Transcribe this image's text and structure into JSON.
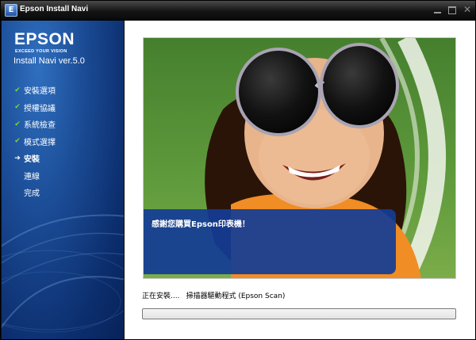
{
  "window": {
    "title": "Epson Install Navi",
    "app_icon_letter": "E",
    "controls": [
      "minimize",
      "maximize",
      "close"
    ]
  },
  "sidebar": {
    "brand": "EPSON",
    "tagline": "EXCEED YOUR VISION",
    "product": "Install Navi ver.5.0",
    "steps": [
      {
        "label": "安裝選項",
        "state": "done"
      },
      {
        "label": "授權協議",
        "state": "done"
      },
      {
        "label": "系統檢查",
        "state": "done"
      },
      {
        "label": "模式選擇",
        "state": "done"
      },
      {
        "label": "安裝",
        "state": "current"
      },
      {
        "label": "連線",
        "state": "pending"
      },
      {
        "label": "完成",
        "state": "pending"
      }
    ]
  },
  "main": {
    "banner_message": "感謝您購買Epson印表機！",
    "status_prefix": "正在安裝....",
    "status_item": "掃描器驅動程式 (Epson Scan)",
    "progress": 0
  },
  "icons": {
    "check": "✔",
    "arrow": "➔"
  },
  "colors": {
    "sidebar": "#1a4a93",
    "overlay": "#143c96",
    "check": "#7fd33a"
  }
}
